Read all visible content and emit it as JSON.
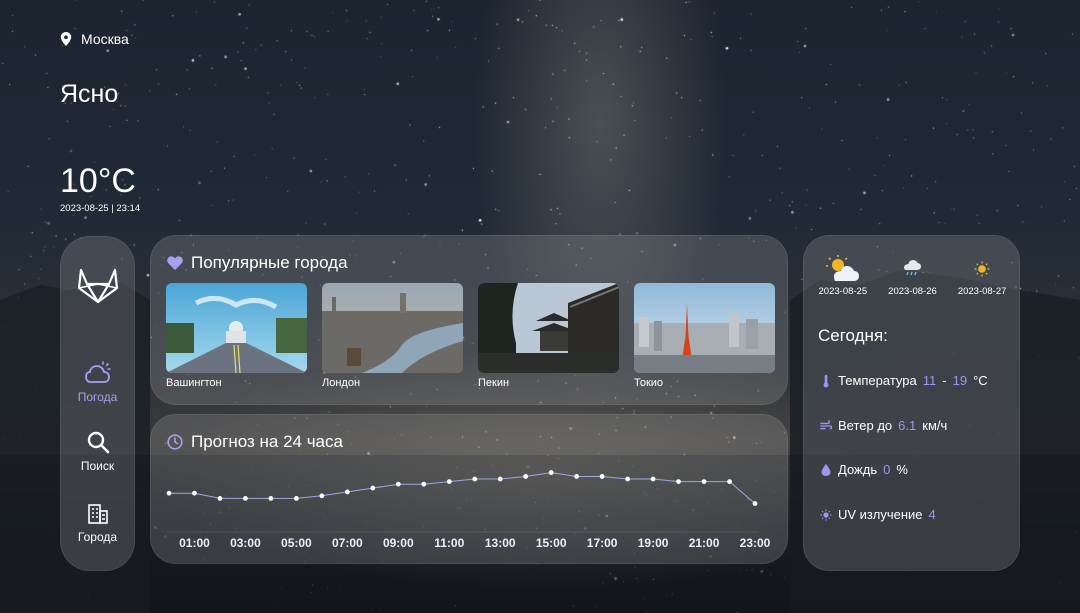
{
  "location": {
    "city": "Москва"
  },
  "current": {
    "condition": "Ясно",
    "temperature": "10°C",
    "date": "2023-08-25",
    "time": "23:14",
    "datetime": "2023-08-25 | 23:14"
  },
  "sidebar": {
    "items": [
      {
        "label": "Погода",
        "icon": "cloud-moon-icon",
        "active": true
      },
      {
        "label": "Поиск",
        "icon": "search-icon",
        "active": false
      },
      {
        "label": "Города",
        "icon": "buildings-icon",
        "active": false
      }
    ]
  },
  "popular": {
    "title": "Популярные города",
    "icon": "heart-icon",
    "cities": [
      {
        "name": "Вашингтон"
      },
      {
        "name": "Лондон"
      },
      {
        "name": "Пекин"
      },
      {
        "name": "Токио"
      }
    ]
  },
  "forecast": {
    "title": "Прогноз на 24 часа",
    "icon": "clock-icon"
  },
  "chart_data": {
    "type": "line",
    "x": [
      "00:00",
      "01:00",
      "02:00",
      "03:00",
      "04:00",
      "05:00",
      "06:00",
      "07:00",
      "08:00",
      "09:00",
      "10:00",
      "11:00",
      "12:00",
      "13:00",
      "14:00",
      "15:00",
      "16:00",
      "17:00",
      "18:00",
      "19:00",
      "20:00",
      "21:00",
      "22:00",
      "23:00"
    ],
    "values": [
      12.8,
      12.8,
      12.4,
      12.4,
      12.4,
      12.4,
      12.6,
      12.9,
      13.2,
      13.5,
      13.5,
      13.7,
      13.9,
      13.9,
      14.1,
      14.4,
      14.1,
      14.1,
      13.9,
      13.9,
      13.7,
      13.7,
      13.7,
      12.0
    ],
    "tick_labels": [
      "01:00",
      "03:00",
      "05:00",
      "07:00",
      "09:00",
      "11:00",
      "13:00",
      "15:00",
      "17:00",
      "19:00",
      "21:00",
      "23:00"
    ],
    "line_color": "#9fa8e8",
    "point_color": "#ffffff"
  },
  "days": [
    {
      "date": "2023-08-25",
      "icon": "sun-cloud-icon"
    },
    {
      "date": "2023-08-26",
      "icon": "rain-cloud-icon"
    },
    {
      "date": "2023-08-27",
      "icon": "sun-icon"
    }
  ],
  "today": {
    "title": "Сегодня:",
    "temperature": {
      "label": "Температура",
      "min": "11",
      "sep": "-",
      "max": "19",
      "unit": "°C"
    },
    "wind": {
      "label": "Ветер до",
      "value": "6.1",
      "unit": "км/ч"
    },
    "rain": {
      "label": "Дождь",
      "value": "0",
      "unit": "%"
    },
    "uv": {
      "label": "UV излучение",
      "value": "4"
    }
  },
  "colors": {
    "accent": "#a89ff0",
    "accent_text": "#9d98ee"
  }
}
